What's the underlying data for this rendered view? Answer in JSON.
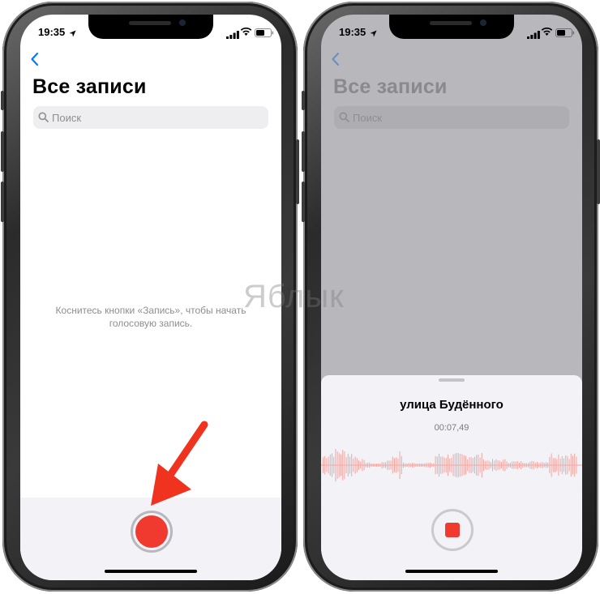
{
  "status_bar": {
    "time": "19:35"
  },
  "left_screen": {
    "title": "Все записи",
    "search_placeholder": "Поиск",
    "empty_hint_line1": "Коснитесь кнопки «Запись», чтобы начать",
    "empty_hint_line2": "голосовую запись."
  },
  "right_screen": {
    "title": "Все записи",
    "search_placeholder": "Поиск",
    "recording_name": "улица Будённого",
    "recording_time": "00:07,49"
  },
  "watermark": "Яблык",
  "icons": {
    "back": "chevron-left-icon",
    "search": "magnifier-icon",
    "record": "record-circle-icon",
    "stop": "stop-square-icon",
    "annotation": "red-arrow-icon"
  },
  "colors": {
    "accent": "#f03a30",
    "link": "#007aff"
  }
}
